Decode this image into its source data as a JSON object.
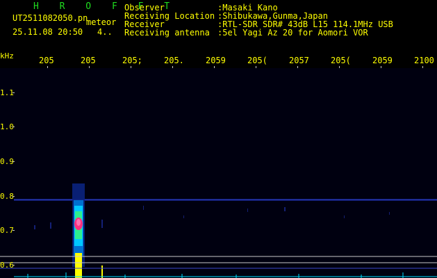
{
  "header": {
    "app_name": "H R O F F T",
    "filename": "UT2511082050.pn",
    "event_label": "meteor",
    "datetime": "25.11.08 20:50",
    "value": "4..",
    "info_rows": [
      {
        "label": "Observer",
        "value": ":Masaki Kano"
      },
      {
        "label": "Receiving Location",
        "value": ":Shibukawa,Gunma,Japan"
      },
      {
        "label": "Receiver",
        "value": ":RTL-SDR SDR# 43dB L15 114.1MHz USB"
      },
      {
        "label": "Receiving antenna",
        "value": ":5el Yagi Az 20 for Aomori VOR"
      }
    ]
  },
  "axes": {
    "y_unit": "kHz",
    "x_tick_labels": [
      "205",
      "205",
      "205;",
      "205.",
      "2059",
      "205(",
      "2057",
      "205(",
      "2059",
      "2100"
    ],
    "y_tick_labels": [
      "1.1",
      "1.0",
      "0.9",
      "0.8",
      "0.7",
      "0.6"
    ]
  },
  "colors": {
    "text": "#ffff00",
    "title": "#1fdc1f",
    "background": "#000000",
    "plot_background": "#000010",
    "meteor_core": "#ff3080",
    "meteor_halo": "#00c8ff",
    "signal": "#ffff00",
    "noise": "#2030a0"
  }
}
